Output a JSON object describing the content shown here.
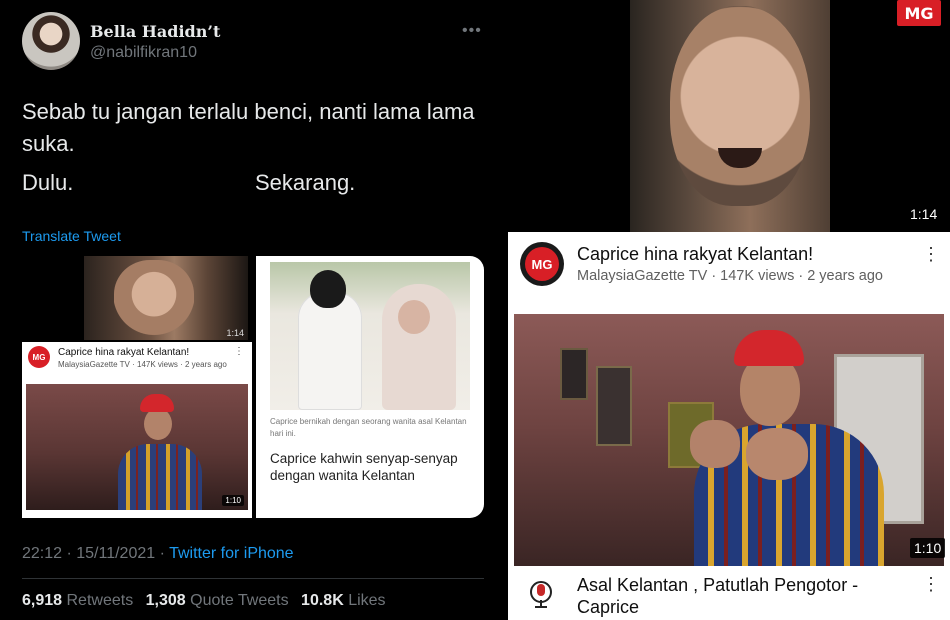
{
  "tweet": {
    "display_name": "Bella Hadidn’t",
    "handle": "@nabilfikran10",
    "text": "Sebab tu jangan terlalu benci, nanti lama lama suka.",
    "label_before": "Dulu.",
    "label_after": "Sekarang.",
    "translate_label": "Translate Tweet",
    "more_icon": "more-horizontal-icon",
    "timestamp": "22:12 · 15/11/2021 · ",
    "source": "Twitter for iPhone",
    "stats": {
      "retweets_count": "6,918",
      "retweets_label": "Retweets",
      "quotes_count": "1,308",
      "quotes_label": "Quote Tweets",
      "likes_count": "10.8K",
      "likes_label": "Likes"
    }
  },
  "media_left": {
    "video_time": "1:14",
    "channel_logo": "MG",
    "video_title": "Caprice hina rakyat Kelantan!",
    "video_meta": "MalaysiaGazette TV · 147K views · 2 years ago",
    "duration": "1:10"
  },
  "media_right": {
    "caption": "Caprice bernikah dengan seorang wanita asal Kelantan hari ini.",
    "headline": "Caprice kahwin senyap-senyap dengan wanita Kelantan"
  },
  "right_panel": {
    "top_video_badge": "MG",
    "top_video_time": "1:14",
    "channel_logo": "MG",
    "video_title": "Caprice hina rakyat Kelantan!",
    "video_meta": "MalaysiaGazette TV · 147K views · 2 years ago",
    "duration": "1:10",
    "next_video_title": "Asal Kelantan , Patutlah Pengotor - Caprice",
    "kebab_icon": "more-vertical-icon"
  },
  "colors": {
    "background": "#000000",
    "link_blue": "#1d9bf0",
    "muted_gray": "#71767b",
    "brand_red": "#d81f26"
  }
}
